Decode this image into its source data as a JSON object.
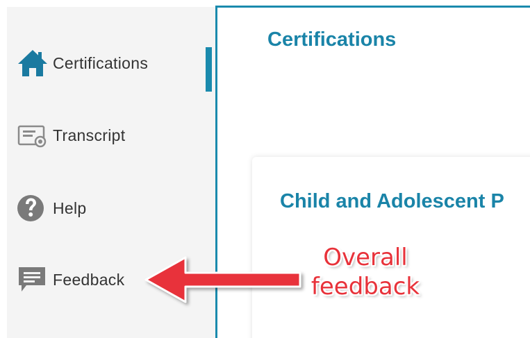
{
  "sidebar": {
    "items": [
      {
        "label": "Certifications",
        "icon": "home-icon",
        "active": true
      },
      {
        "label": "Transcript",
        "icon": "certificate-icon",
        "active": false
      },
      {
        "label": "Help",
        "icon": "help-icon",
        "active": false
      },
      {
        "label": "Feedback",
        "icon": "feedback-icon",
        "active": false
      }
    ]
  },
  "main": {
    "title": "Certifications",
    "card": {
      "title": "Child and Adolescent P"
    }
  },
  "annotation": {
    "line1": "Overall",
    "line2": "feedback"
  },
  "colors": {
    "accent": "#1a8aad",
    "annotation": "#e8323a",
    "sidebar_bg": "#f4f4f4",
    "icon_gray": "#7a7a7a"
  }
}
